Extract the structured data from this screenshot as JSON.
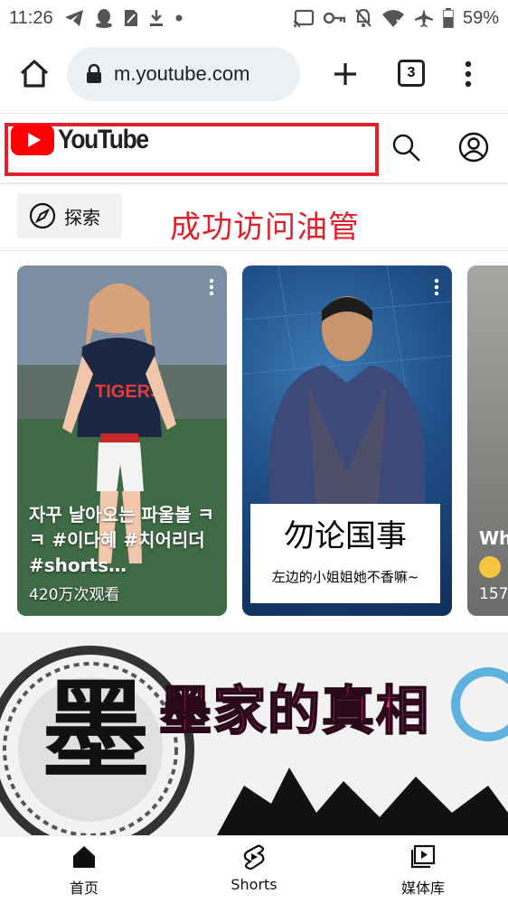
{
  "status_bar": {
    "time": "11:26",
    "battery": "59%",
    "left_icons": [
      "telegram-icon",
      "qq-icon",
      "sim-icon",
      "download-icon",
      "dot-icon"
    ],
    "right_icons": [
      "cast-icon",
      "vpn-key-icon",
      "bell-off-icon",
      "wifi-x-icon",
      "airplane-icon",
      "battery-icon"
    ]
  },
  "browser": {
    "url": "m.youtube.com",
    "tab_count": "3"
  },
  "youtube": {
    "logo_text": "YouTube",
    "brand_color": "#ff0000"
  },
  "chips": {
    "explore_label": "探索"
  },
  "annotation": "成功访问油管",
  "shorts": [
    {
      "title": "자꾸 날아오는 파울볼 ㅋㅋ #이다혜 #치어리더 #shorts…",
      "views": "420万次观看"
    },
    {
      "overlay_title": "勿论国事",
      "overlay_subtitle": "左边的小姐姐她不香嘛~"
    },
    {
      "title": "Wh",
      "views": "157"
    }
  ],
  "video": {
    "thumbnail_text": "墨家的真相",
    "thumbnail_seal_text": "墨"
  },
  "bottom_nav": {
    "home": "首页",
    "shorts": "Shorts",
    "library": "媒体库"
  }
}
